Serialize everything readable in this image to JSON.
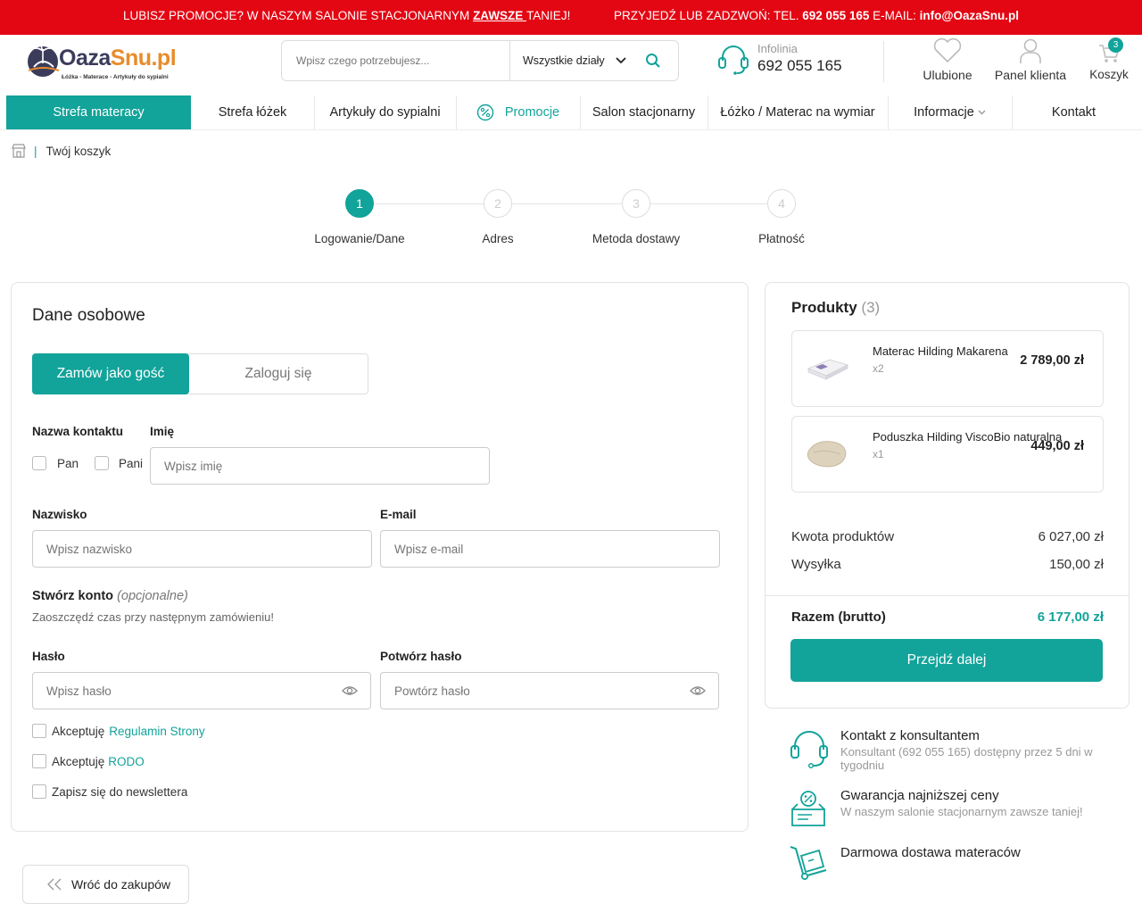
{
  "promo": {
    "left_prefix": "LUBISZ PROMOCJE? W NASZYM SALONIE STACJONARNYM ",
    "left_emph": "ZAWSZE ",
    "left_suffix": "TANIEJ!",
    "right_prefix": "PRZYJEDŹ LUB ZADZWOŃ: TEL. ",
    "right_tel": "692 055 165",
    "right_mid": " E-MAIL: ",
    "right_email": "info@OazaSnu.pl"
  },
  "logo": {
    "part1": "Oaza",
    "part2": "Snu.pl",
    "tagline": "Łóżka - Materace - Artykuły do sypialni"
  },
  "search": {
    "placeholder": "Wpisz czego potrzebujesz...",
    "category": "Wszystkie działy"
  },
  "infolinia": {
    "label": "Infolinia",
    "phone": "692 055 165"
  },
  "header_actions": {
    "favorites": "Ulubione",
    "account": "Panel klienta",
    "cart": "Koszyk",
    "cart_count": "3"
  },
  "nav": [
    {
      "label": "Strefa materacy"
    },
    {
      "label": "Strefa łóżek"
    },
    {
      "label": "Artykuły do sypialni"
    },
    {
      "label": "Promocje"
    },
    {
      "label": "Salon stacjonarny"
    },
    {
      "label": "Łóżko / Materac na wymiar"
    },
    {
      "label": "Informacje"
    },
    {
      "label": "Kontakt"
    }
  ],
  "breadcrumb": {
    "current": "Twój koszyk"
  },
  "steps": [
    {
      "num": "1",
      "label": "Logowanie/Dane"
    },
    {
      "num": "2",
      "label": "Adres"
    },
    {
      "num": "3",
      "label": "Metoda dostawy"
    },
    {
      "num": "4",
      "label": "Płatność"
    }
  ],
  "form": {
    "title": "Dane osobowe",
    "guest_tab": "Zamów jako gość",
    "login_tab": "Zaloguj się",
    "contact_label": "Nazwa kontaktu",
    "pan": "Pan",
    "pani": "Pani",
    "first_name_label": "Imię",
    "first_name_placeholder": "Wpisz imię",
    "last_name_label": "Nazwisko",
    "last_name_placeholder": "Wpisz nazwisko",
    "email_label": "E-mail",
    "email_placeholder": "Wpisz e-mail",
    "create_account": "Stwórz konto",
    "optional": "(opcjonalne)",
    "create_account_sub": "Zaoszczędź czas przy następnym zamówieniu!",
    "password_label": "Hasło",
    "password_placeholder": "Wpisz hasło",
    "confirm_label": "Potwórz hasło",
    "confirm_placeholder": "Powtórz hasło",
    "accept_prefix": "Akceptuję",
    "terms_link": "Regulamin Strony",
    "rodo_link": "RODO",
    "newsletter": "Zapisz się do newslettera",
    "back": "Wróć do zakupów"
  },
  "summary": {
    "title": "Produkty",
    "count": "(3)",
    "products": [
      {
        "name": "Materac Hilding Makarena",
        "qty": "x2",
        "price": "2 789,00 zł"
      },
      {
        "name": "Poduszka Hilding ViscoBio naturalna",
        "qty": "x1",
        "price": "449,00 zł"
      }
    ],
    "products_total_label": "Kwota produktów",
    "products_total": "6 027,00 zł",
    "shipping_label": "Wysyłka",
    "shipping": "150,00 zł",
    "total_label": "Razem (brutto)",
    "total": "6 177,00 zł",
    "next": "Przejdź dalej"
  },
  "benefits": [
    {
      "title": "Kontakt z konsultantem",
      "desc": "Konsultant (692 055 165) dostępny przez 5 dni w tygodniu"
    },
    {
      "title": "Gwarancja najniższej ceny",
      "desc": "W naszym salonie stacjonarnym zawsze taniej!"
    },
    {
      "title": "Darmowa dostawa materaców",
      "desc": ""
    }
  ],
  "colors": {
    "accent": "#12a39a",
    "promo_bar": "#e30613",
    "logo_dark": "#3b3b5c",
    "logo_orange": "#e88c2b"
  }
}
